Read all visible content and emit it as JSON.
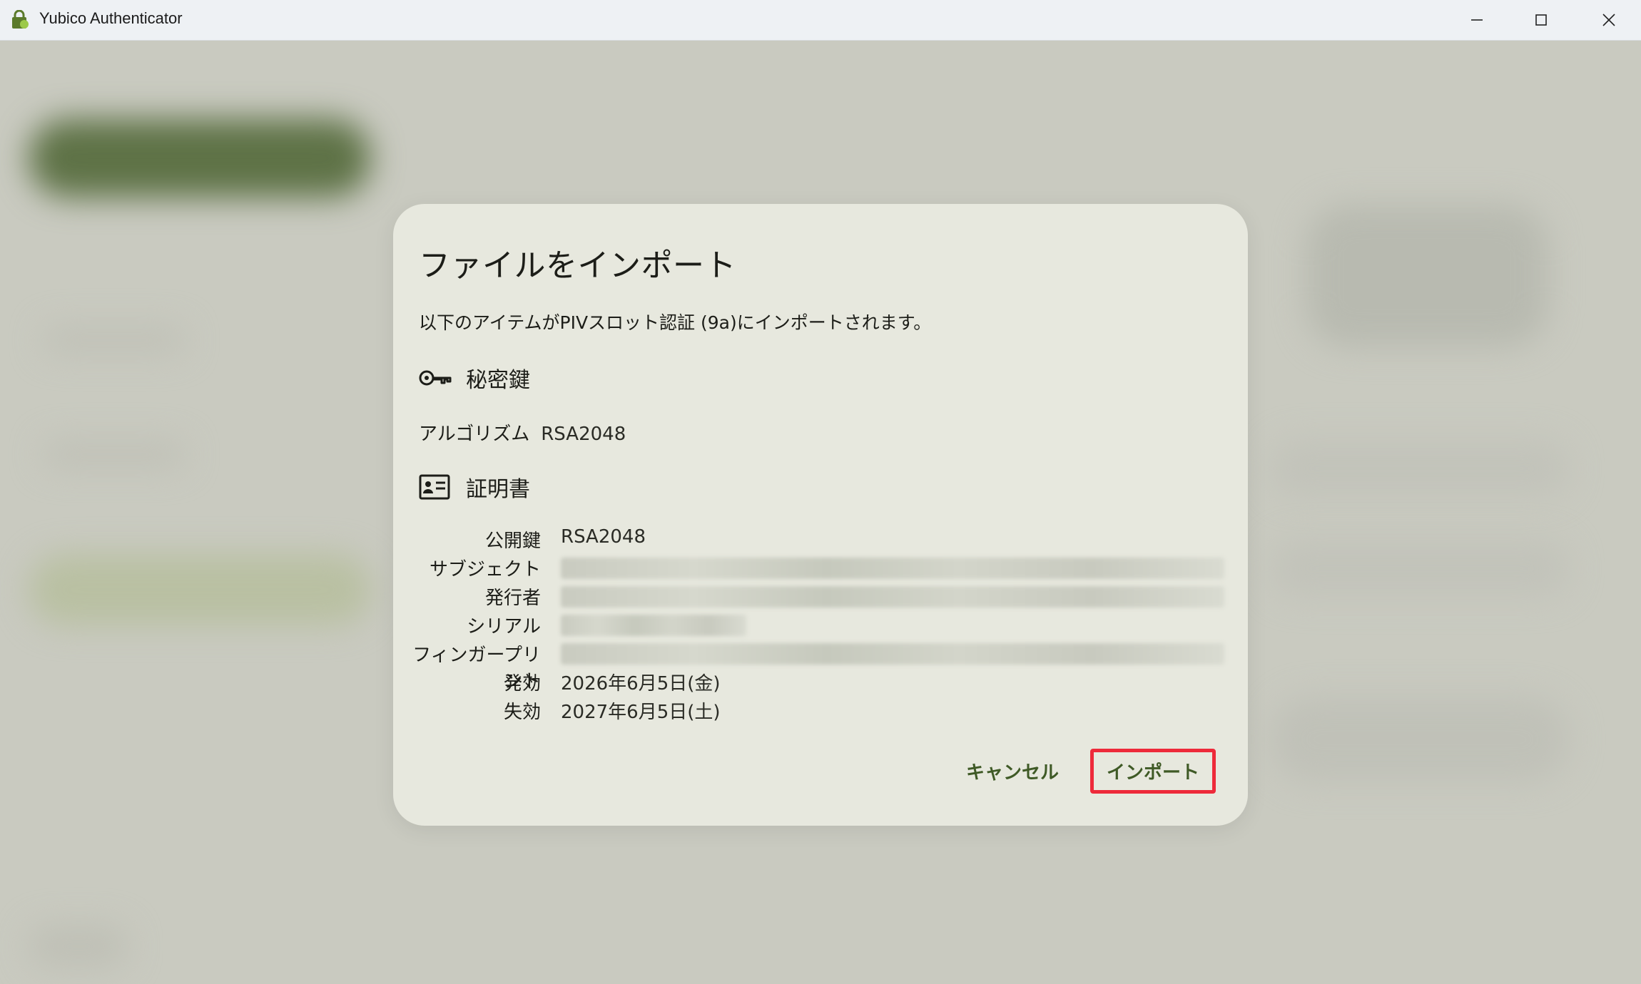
{
  "window": {
    "title": "Yubico Authenticator",
    "controls": {
      "minimize": "minimize-icon",
      "maximize": "maximize-icon",
      "close": "close-icon"
    }
  },
  "dialog": {
    "title": "ファイルをインポート",
    "description": "以下のアイテムがPIVスロット認証 (9a)にインポートされます。",
    "private_key": {
      "label": "秘密鍵",
      "icon": "key-icon",
      "algorithm_label": "アルゴリズム",
      "algorithm_value": "RSA2048"
    },
    "certificate": {
      "label": "証明書",
      "icon": "id-card-icon",
      "fields": [
        {
          "key": "公開鍵",
          "value": "RSA2048"
        },
        {
          "key": "サブジェクト",
          "value": ""
        },
        {
          "key": "発行者",
          "value": ""
        },
        {
          "key": "シリアル",
          "value": ""
        },
        {
          "key": "フィンガープリント",
          "value": ""
        },
        {
          "key": "発効",
          "value": "2026年6月5日(金)"
        },
        {
          "key": "失効",
          "value": "2027年6月5日(土)"
        }
      ]
    },
    "actions": {
      "cancel": "キャンセル",
      "import": "インポート"
    }
  },
  "colors": {
    "accent": "#3f5a26",
    "highlight": "#ee2a3a",
    "dialog_bg": "#e7e8de",
    "backdrop": "#c9cac0"
  }
}
